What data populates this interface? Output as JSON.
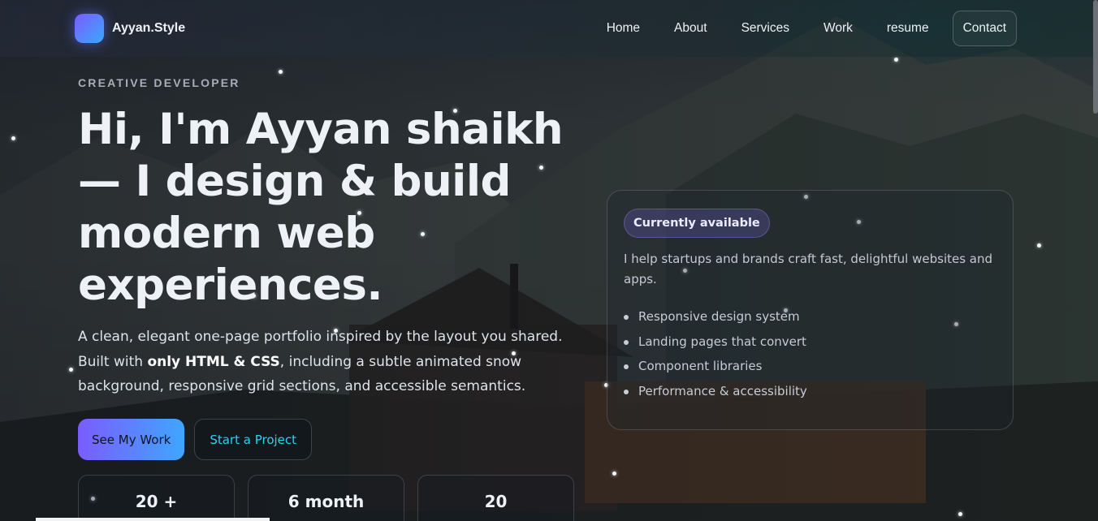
{
  "header": {
    "brand": "Ayyan.Style",
    "nav": {
      "home": "Home",
      "about": "About",
      "services": "Services",
      "work": "Work",
      "resume": "resume",
      "contact": "Contact"
    }
  },
  "hero": {
    "eyebrow": "CREATIVE DEVELOPER",
    "title": "Hi, I'm Ayyan shaikh — I design & build modern web experiences.",
    "description": {
      "before": "A clean, elegant one-page portfolio inspired by the layout you shared. Built with ",
      "strong": "only HTML & CSS",
      "after": ", including a subtle animated snow background, responsive grid sections, and accessible semantics."
    },
    "primary_cta": "See My Work",
    "secondary_cta": "Start a Project",
    "stats": [
      "20 +",
      "6 month",
      "20"
    ]
  },
  "availability": {
    "badge": "Currently available",
    "text": "I help startups and brands craft fast, delightful websites and apps.",
    "items": [
      "Responsive design system",
      "Landing pages that convert",
      "Component libraries",
      "Performance & accessibility"
    ]
  },
  "colors": {
    "accent_start": "#7b5cff",
    "accent_end": "#3fa6ff",
    "secondary_link": "#27d3f2"
  }
}
